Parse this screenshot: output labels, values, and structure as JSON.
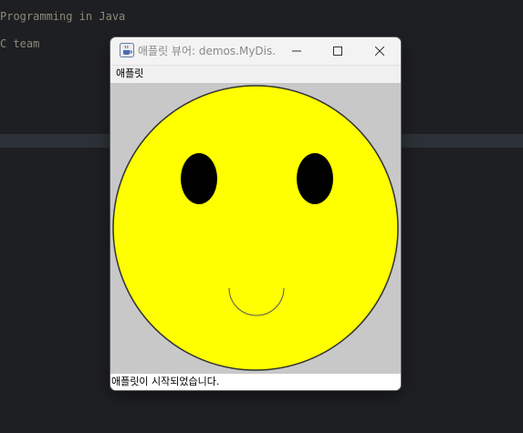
{
  "editor": {
    "line1": "Programming in Java",
    "line2": "C team"
  },
  "window": {
    "title": "애플릿 뷰어: demos.MyDis...",
    "icon": "java-cup-icon"
  },
  "menu": {
    "applet_label": "애플릿"
  },
  "status": {
    "text": "애플릿이 시작되었습니다."
  },
  "colors": {
    "face_fill": "#ffff00",
    "eye_fill": "#000000",
    "canvas_bg": "#c8c8c8",
    "ide_bg": "#1e1f22"
  }
}
